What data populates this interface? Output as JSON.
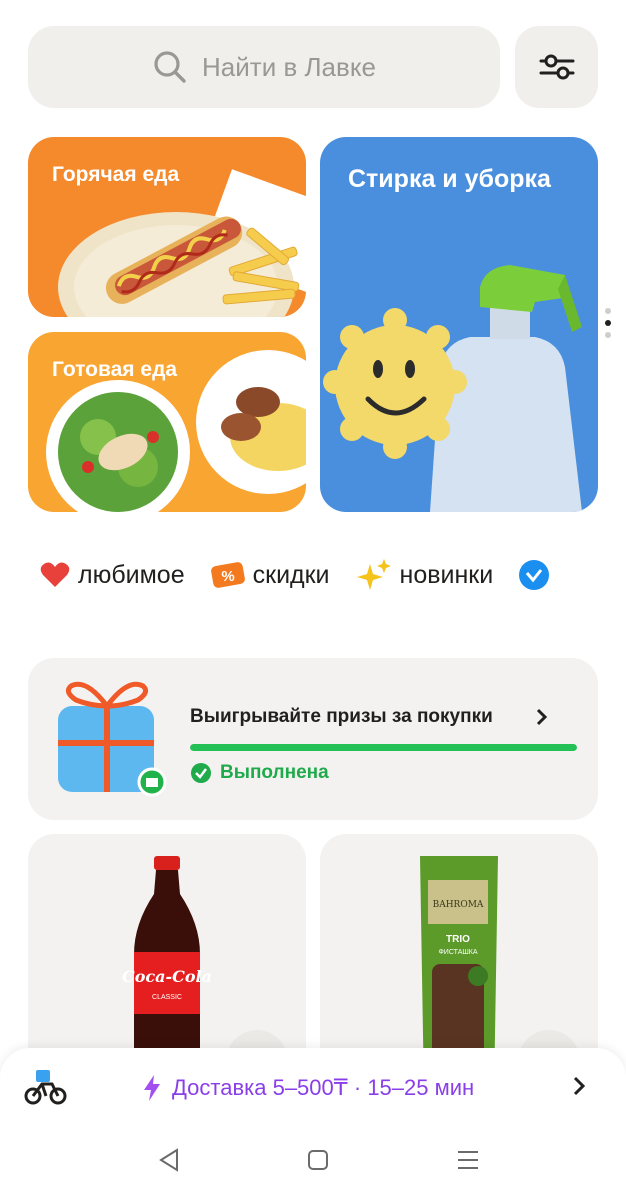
{
  "search": {
    "placeholder": "Найти в Лавке",
    "icon": "search-icon"
  },
  "filters_icon": "sliders-icon",
  "tiles": {
    "hot_food": {
      "label": "Горячая еда"
    },
    "ready_food": {
      "label": "Готовая еда"
    },
    "cleaning": {
      "label": "Стирка и уборка"
    }
  },
  "chips": [
    {
      "label": "любимое",
      "icon": "heart-icon"
    },
    {
      "label": "скидки",
      "icon": "discount-icon"
    },
    {
      "label": "новинки",
      "icon": "sparkles-icon"
    }
  ],
  "prize": {
    "title": "Выигрывайте призы за покупки",
    "status": "Выполнена",
    "progress": 1.0
  },
  "products": [
    {
      "name": "Coca-Cola Classic"
    },
    {
      "name": "BAHROMA TRIO Фисташка"
    }
  ],
  "delivery": {
    "text": "Доставка 5–500₸ · 15–25 мин"
  },
  "colors": {
    "accent_purple": "#8a3ee8",
    "success_green": "#22c055",
    "hot_tile": "#f58a2c",
    "ready_tile": "#f9a531",
    "clean_tile": "#4a8fdd"
  }
}
